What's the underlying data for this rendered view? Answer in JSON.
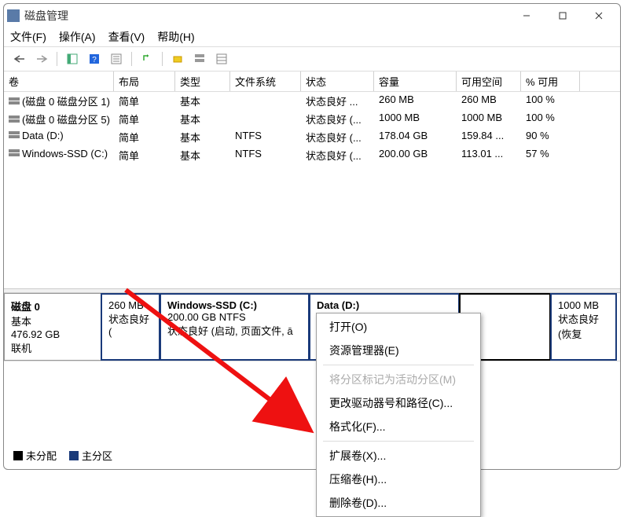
{
  "window": {
    "title": "磁盘管理"
  },
  "menu": {
    "file": "文件(F)",
    "action": "操作(A)",
    "view": "查看(V)",
    "help": "帮助(H)"
  },
  "columns": {
    "c0": "卷",
    "c1": "布局",
    "c2": "类型",
    "c3": "文件系统",
    "c4": "状态",
    "c5": "容量",
    "c6": "可用空间",
    "c7": "% 可用"
  },
  "volumes": [
    {
      "name": "(磁盘 0 磁盘分区 1)",
      "layout": "简单",
      "type": "基本",
      "fs": "",
      "status": "状态良好 ...",
      "cap": "260 MB",
      "free": "260 MB",
      "pct": "100 %"
    },
    {
      "name": "(磁盘 0 磁盘分区 5)",
      "layout": "简单",
      "type": "基本",
      "fs": "",
      "status": "状态良好 (...",
      "cap": "1000 MB",
      "free": "1000 MB",
      "pct": "100 %"
    },
    {
      "name": "Data (D:)",
      "layout": "简单",
      "type": "基本",
      "fs": "NTFS",
      "status": "状态良好 (...",
      "cap": "178.04 GB",
      "free": "159.84 ...",
      "pct": "90 %"
    },
    {
      "name": "Windows-SSD (C:)",
      "layout": "简单",
      "type": "基本",
      "fs": "NTFS",
      "status": "状态良好 (...",
      "cap": "200.00 GB",
      "free": "113.01 ...",
      "pct": "57 %"
    }
  ],
  "disk": {
    "name": "磁盘 0",
    "kind": "基本",
    "size": "476.92 GB",
    "status": "联机",
    "parts": [
      {
        "title": "",
        "line2": "260 MB",
        "line3": "状态良好 ("
      },
      {
        "title": "Windows-SSD  (C:)",
        "line2": "200.00 GB NTFS",
        "line3": "状态良好 (启动, 页面文件, ā"
      },
      {
        "title": "Data  (D:)",
        "line2": "",
        "line3": ""
      },
      {
        "title": "",
        "line2": "",
        "line3": ""
      },
      {
        "title": "",
        "line2": "1000 MB",
        "line3": "状态良好 (恢复"
      }
    ]
  },
  "legend": {
    "unallocated": "未分配",
    "primary": "主分区"
  },
  "context": {
    "open": "打开(O)",
    "explorer": "资源管理器(E)",
    "mark_active": "将分区标记为活动分区(M)",
    "change_letter": "更改驱动器号和路径(C)...",
    "format": "格式化(F)...",
    "extend": "扩展卷(X)...",
    "shrink": "压缩卷(H)...",
    "delete": "删除卷(D)..."
  }
}
